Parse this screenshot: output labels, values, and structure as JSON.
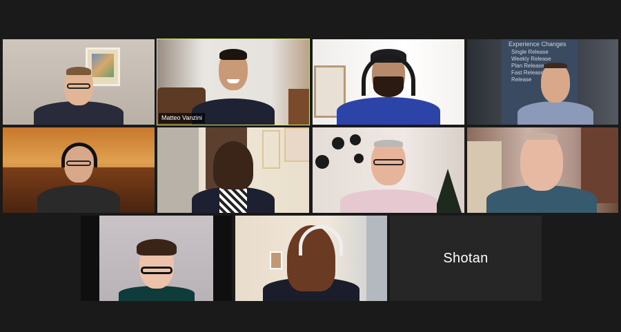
{
  "meeting": {
    "view": "gallery",
    "participants": [
      {
        "id": "p1",
        "video": "on",
        "shirt_color": "#2a2b3a",
        "skin": "#e2b594",
        "hair": "#7a5a3a"
      },
      {
        "id": "p2",
        "video": "on",
        "name_label": "Matteo Vanzini",
        "active_speaker": true,
        "shirt_color": "#1f2233",
        "skin": "#c99a78",
        "hair": "#1b1410"
      },
      {
        "id": "p3",
        "video": "on",
        "shirt_color": "#2c44a8",
        "skin": "#b78a6a",
        "headwear": "headphones"
      },
      {
        "id": "p4",
        "video": "on",
        "shirt_color": "#8a9ab8",
        "skin": "#d9a88a",
        "background_text": [
          "Experience Changes",
          "Single Release",
          "Weekly Release",
          "Plan Release",
          "Fast Release",
          "Release"
        ]
      },
      {
        "id": "p5",
        "video": "on",
        "shirt_color": "#2a2a2a",
        "skin": "#d7a98a",
        "headwear": "headphones"
      },
      {
        "id": "p6",
        "video": "on",
        "shirt_color": "#1c2030",
        "skin": "#efc9b0",
        "hair": "#3b2418"
      },
      {
        "id": "p7",
        "video": "on",
        "shirt_color": "#e6c9d0",
        "skin": "#e5b49a",
        "hair": "#b9b9b9"
      },
      {
        "id": "p8",
        "video": "on",
        "shirt_color": "#385a6e",
        "skin": "#e7b8a2",
        "hair": "#c8b0a0"
      },
      {
        "id": "p9",
        "video": "on",
        "shirt_color": "#0f3b3b",
        "skin": "#ecc2aa",
        "hair": "#3a2418"
      },
      {
        "id": "p10",
        "video": "on",
        "shirt_color": "#1b1d2a",
        "skin": "#f0c6ad",
        "hair": "#6b3a22",
        "headwear": "headphones"
      },
      {
        "id": "p11",
        "video": "off",
        "display_name": "Shotan"
      }
    ]
  }
}
